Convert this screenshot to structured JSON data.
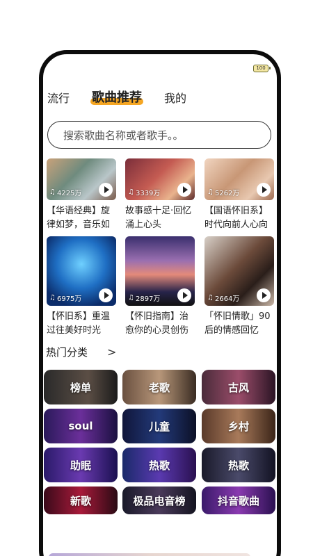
{
  "status": {
    "battery": "100"
  },
  "tabs": [
    {
      "label": "流行"
    },
    {
      "label": "歌曲推荐"
    },
    {
      "label": "我的"
    }
  ],
  "search": {
    "placeholder": "搜索歌曲名称或者歌手。。"
  },
  "cards": [
    {
      "plays": "4225万",
      "title": "【华语经典】旋律如梦，音乐如"
    },
    {
      "plays": "3339万",
      "title": "故事感十足·回忆涌上心头"
    },
    {
      "plays": "5262万",
      "title": "【国语怀旧系】时代向前人心向"
    },
    {
      "plays": "6975万",
      "title": "【怀旧系】重温过往美好时光"
    },
    {
      "plays": "2897万",
      "title": "【怀旧指南】治愈你的心灵创伤"
    },
    {
      "plays": "2664万",
      "title": "「怀旧情歌」90后的情感回忆"
    }
  ],
  "hot": {
    "title": "热门分类",
    "categories": [
      {
        "label": "榜单"
      },
      {
        "label": "老歌"
      },
      {
        "label": "古风"
      },
      {
        "label": "soul"
      },
      {
        "label": "儿童"
      },
      {
        "label": "乡村"
      },
      {
        "label": "助眠"
      },
      {
        "label": "热歌"
      },
      {
        "label": "热歌"
      },
      {
        "label": "新歌"
      },
      {
        "label": "极品电音榜"
      },
      {
        "label": "抖音歌曲"
      }
    ]
  }
}
